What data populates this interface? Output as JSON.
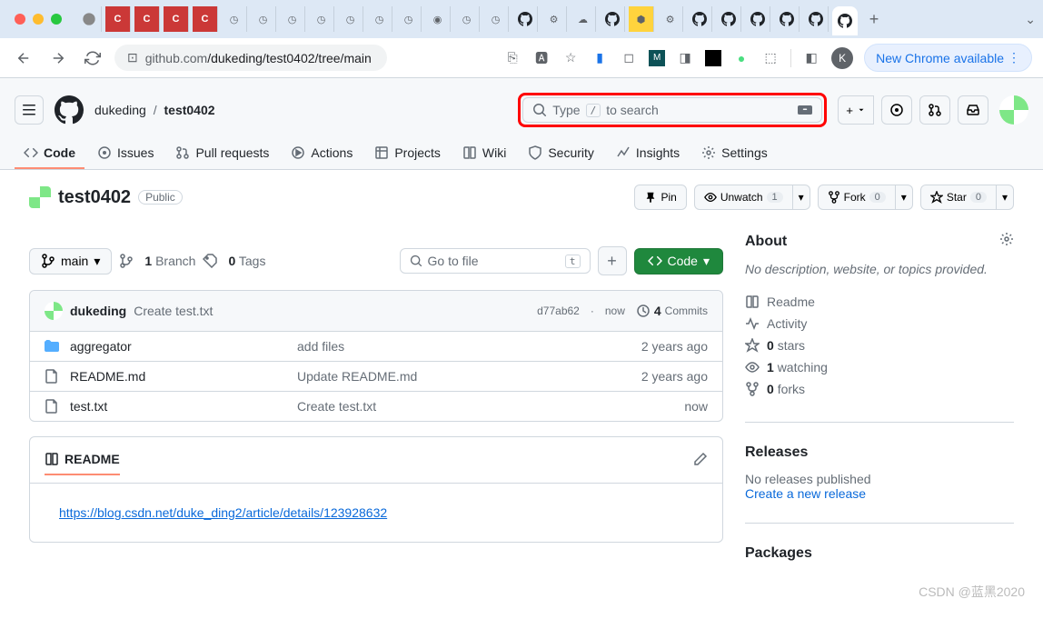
{
  "browser": {
    "url_host": "github.com",
    "url_path": "/dukeding/test0402/tree/main",
    "update_label": "New Chrome available",
    "avatar_letter": "K"
  },
  "header": {
    "owner": "dukeding",
    "repo": "test0402",
    "search_prefix": "Type",
    "search_key": "/",
    "search_suffix": "to search"
  },
  "nav": {
    "code": "Code",
    "issues": "Issues",
    "pull_requests": "Pull requests",
    "actions": "Actions",
    "projects": "Projects",
    "wiki": "Wiki",
    "security": "Security",
    "insights": "Insights",
    "settings": "Settings"
  },
  "repo": {
    "name": "test0402",
    "visibility": "Public",
    "pin": "Pin",
    "unwatch": "Unwatch",
    "unwatch_count": "1",
    "fork": "Fork",
    "fork_count": "0",
    "star": "Star",
    "star_count": "0"
  },
  "branch": {
    "current": "main",
    "branches_count": "1",
    "branches_label": "Branch",
    "tags_count": "0",
    "tags_label": "Tags",
    "goto_file": "Go to file",
    "goto_key": "t",
    "code_btn": "Code"
  },
  "commit": {
    "author": "dukeding",
    "message": "Create test.txt",
    "sha": "d77ab62",
    "time": "now",
    "count": "4",
    "count_label": "Commits"
  },
  "files": [
    {
      "type": "folder",
      "name": "aggregator",
      "msg": "add files",
      "age": "2 years ago"
    },
    {
      "type": "file",
      "name": "README.md",
      "msg": "Update README.md",
      "age": "2 years ago"
    },
    {
      "type": "file",
      "name": "test.txt",
      "msg": "Create test.txt",
      "age": "now"
    }
  ],
  "readme": {
    "title": "README",
    "content_link": "https://blog.csdn.net/duke_ding2/article/details/123928632"
  },
  "about": {
    "heading": "About",
    "description": "No description, website, or topics provided.",
    "readme": "Readme",
    "activity": "Activity",
    "stars_count": "0",
    "stars_label": "stars",
    "watching_count": "1",
    "watching_label": "watching",
    "forks_count": "0",
    "forks_label": "forks"
  },
  "releases": {
    "heading": "Releases",
    "none": "No releases published",
    "create": "Create a new release"
  },
  "packages": {
    "heading": "Packages"
  },
  "watermark": "CSDN @蓝黑2020"
}
